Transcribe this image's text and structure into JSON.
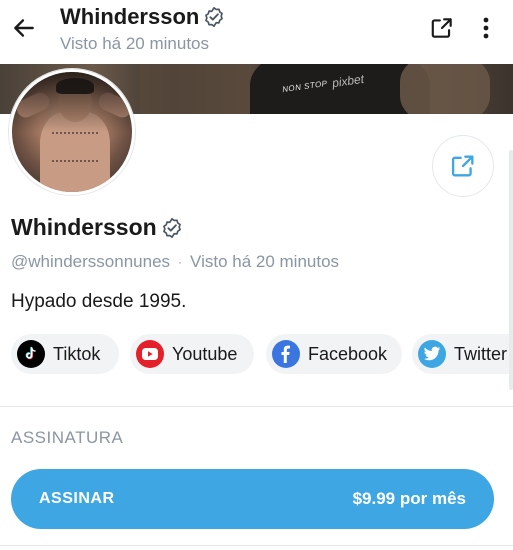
{
  "header": {
    "title": "Whindersson",
    "subtitle": "Visto  há 20 minutos"
  },
  "banner": {
    "text": "NON STOP",
    "brand": "pixbet"
  },
  "profile": {
    "name": "Whindersson",
    "handle": "@whinderssonnunes",
    "separator": "·",
    "last_seen": "Visto  há 20 minutos",
    "bio": "Hypado desde 1995."
  },
  "socials": [
    {
      "label": "Tiktok",
      "icon": "tiktok-icon",
      "color": "#000000"
    },
    {
      "label": "Youtube",
      "icon": "youtube-icon",
      "color": "#e4202a"
    },
    {
      "label": "Facebook",
      "icon": "facebook-icon",
      "color": "#3b76e0"
    },
    {
      "label": "Twitter",
      "icon": "twitter-icon",
      "color": "#3fa6e4"
    }
  ],
  "subscription": {
    "section_label": "ASSINATURA",
    "button_label": "ASSINAR",
    "price": "$9.99 por mês"
  },
  "colors": {
    "accent": "#3fa6e4",
    "muted_text": "#8a96a3",
    "pill_bg": "#f2f3f5"
  }
}
